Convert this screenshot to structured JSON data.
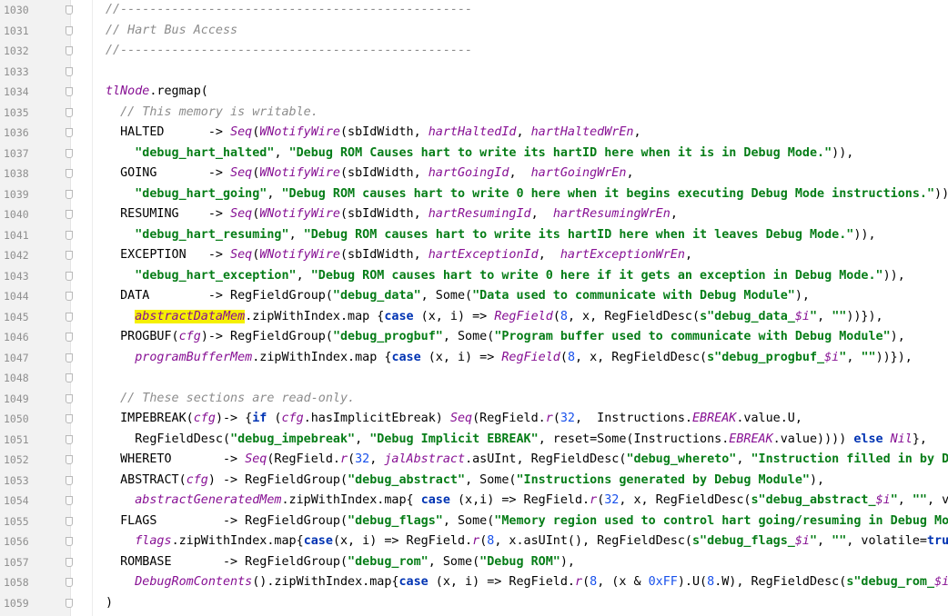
{
  "editor": {
    "lines": [
      {
        "num": "1030",
        "tokens": [
          {
            "t": "cm",
            "v": "//------------------------------------------------"
          }
        ]
      },
      {
        "num": "1031",
        "tokens": [
          {
            "t": "cm",
            "v": "// Hart Bus Access"
          }
        ]
      },
      {
        "num": "1032",
        "tokens": [
          {
            "t": "cm",
            "v": "//------------------------------------------------"
          }
        ]
      },
      {
        "num": "1033",
        "tokens": []
      },
      {
        "num": "1034",
        "tokens": [
          {
            "t": "fn",
            "v": "tlNode"
          },
          {
            "t": "p",
            "v": ".regmap("
          }
        ]
      },
      {
        "num": "1035",
        "tokens": [
          {
            "t": "p",
            "v": "  "
          },
          {
            "t": "cm",
            "v": "// This memory is writable."
          }
        ]
      },
      {
        "num": "1036",
        "tokens": [
          {
            "t": "p",
            "v": "  HALTED      -> "
          },
          {
            "t": "fn",
            "v": "Seq"
          },
          {
            "t": "p",
            "v": "("
          },
          {
            "t": "fn",
            "v": "WNotifyWire"
          },
          {
            "t": "p",
            "v": "(sbIdWidth, "
          },
          {
            "t": "fn",
            "v": "hartHaltedId"
          },
          {
            "t": "p",
            "v": ", "
          },
          {
            "t": "fn",
            "v": "hartHaltedWrEn"
          },
          {
            "t": "p",
            "v": ","
          }
        ]
      },
      {
        "num": "1037",
        "tokens": [
          {
            "t": "p",
            "v": "    "
          },
          {
            "t": "str",
            "v": "\"debug_hart_halted\""
          },
          {
            "t": "p",
            "v": ", "
          },
          {
            "t": "str",
            "v": "\"Debug ROM Causes hart to write its hartID here when it is in Debug Mode.\""
          },
          {
            "t": "p",
            "v": ")),"
          }
        ]
      },
      {
        "num": "1038",
        "tokens": [
          {
            "t": "p",
            "v": "  GOING       -> "
          },
          {
            "t": "fn",
            "v": "Seq"
          },
          {
            "t": "p",
            "v": "("
          },
          {
            "t": "fn",
            "v": "WNotifyWire"
          },
          {
            "t": "p",
            "v": "(sbIdWidth, "
          },
          {
            "t": "fn",
            "v": "hartGoingId"
          },
          {
            "t": "p",
            "v": ",  "
          },
          {
            "t": "fn",
            "v": "hartGoingWrEn"
          },
          {
            "t": "p",
            "v": ","
          }
        ]
      },
      {
        "num": "1039",
        "tokens": [
          {
            "t": "p",
            "v": "    "
          },
          {
            "t": "str",
            "v": "\"debug_hart_going\""
          },
          {
            "t": "p",
            "v": ", "
          },
          {
            "t": "str",
            "v": "\"Debug ROM causes hart to write 0 here when it begins executing Debug Mode instructions.\""
          },
          {
            "t": "p",
            "v": ")),"
          }
        ]
      },
      {
        "num": "1040",
        "tokens": [
          {
            "t": "p",
            "v": "  RESUMING    -> "
          },
          {
            "t": "fn",
            "v": "Seq"
          },
          {
            "t": "p",
            "v": "("
          },
          {
            "t": "fn",
            "v": "WNotifyWire"
          },
          {
            "t": "p",
            "v": "(sbIdWidth, "
          },
          {
            "t": "fn",
            "v": "hartResumingId"
          },
          {
            "t": "p",
            "v": ",  "
          },
          {
            "t": "fn",
            "v": "hartResumingWrEn"
          },
          {
            "t": "p",
            "v": ","
          }
        ]
      },
      {
        "num": "1041",
        "tokens": [
          {
            "t": "p",
            "v": "    "
          },
          {
            "t": "str",
            "v": "\"debug_hart_resuming\""
          },
          {
            "t": "p",
            "v": ", "
          },
          {
            "t": "str",
            "v": "\"Debug ROM causes hart to write its hartID here when it leaves Debug Mode.\""
          },
          {
            "t": "p",
            "v": ")),"
          }
        ]
      },
      {
        "num": "1042",
        "tokens": [
          {
            "t": "p",
            "v": "  EXCEPTION   -> "
          },
          {
            "t": "fn",
            "v": "Seq"
          },
          {
            "t": "p",
            "v": "("
          },
          {
            "t": "fn",
            "v": "WNotifyWire"
          },
          {
            "t": "p",
            "v": "(sbIdWidth, "
          },
          {
            "t": "fn",
            "v": "hartExceptionId"
          },
          {
            "t": "p",
            "v": ",  "
          },
          {
            "t": "fn",
            "v": "hartExceptionWrEn"
          },
          {
            "t": "p",
            "v": ","
          }
        ]
      },
      {
        "num": "1043",
        "tokens": [
          {
            "t": "p",
            "v": "    "
          },
          {
            "t": "str",
            "v": "\"debug_hart_exception\""
          },
          {
            "t": "p",
            "v": ", "
          },
          {
            "t": "str",
            "v": "\"Debug ROM causes hart to write 0 here if it gets an exception in Debug Mode.\""
          },
          {
            "t": "p",
            "v": ")),"
          }
        ]
      },
      {
        "num": "1044",
        "tokens": [
          {
            "t": "p",
            "v": "  DATA        -> RegFieldGroup("
          },
          {
            "t": "str",
            "v": "\"debug_data\""
          },
          {
            "t": "p",
            "v": ", Some("
          },
          {
            "t": "str",
            "v": "\"Data used to communicate with Debug Module\""
          },
          {
            "t": "p",
            "v": "),"
          }
        ]
      },
      {
        "num": "1045",
        "tokens": [
          {
            "t": "p",
            "v": "    "
          },
          {
            "t": "fnhl",
            "v": "abstractDataMem"
          },
          {
            "t": "p",
            "v": ".zipWithIndex.map {"
          },
          {
            "t": "kw",
            "v": "case"
          },
          {
            "t": "p",
            "v": " (x, i) => "
          },
          {
            "t": "fn",
            "v": "RegField"
          },
          {
            "t": "p",
            "v": "("
          },
          {
            "t": "num",
            "v": "8"
          },
          {
            "t": "p",
            "v": ", x, RegFieldDesc("
          },
          {
            "t": "str",
            "v": "s\"debug_data_"
          },
          {
            "t": "fn",
            "v": "$i"
          },
          {
            "t": "str",
            "v": "\""
          },
          {
            "t": "p",
            "v": ", "
          },
          {
            "t": "str",
            "v": "\"\""
          },
          {
            "t": "p",
            "v": "))}),"
          }
        ]
      },
      {
        "num": "1046",
        "tokens": [
          {
            "t": "p",
            "v": "  PROGBUF("
          },
          {
            "t": "fn",
            "v": "cfg"
          },
          {
            "t": "p",
            "v": ")-> RegFieldGroup("
          },
          {
            "t": "str",
            "v": "\"debug_progbuf\""
          },
          {
            "t": "p",
            "v": ", Some("
          },
          {
            "t": "str",
            "v": "\"Program buffer used to communicate with Debug Module\""
          },
          {
            "t": "p",
            "v": "),"
          }
        ]
      },
      {
        "num": "1047",
        "tokens": [
          {
            "t": "p",
            "v": "    "
          },
          {
            "t": "fn",
            "v": "programBufferMem"
          },
          {
            "t": "p",
            "v": ".zipWithIndex.map {"
          },
          {
            "t": "kw",
            "v": "case"
          },
          {
            "t": "p",
            "v": " (x, i) => "
          },
          {
            "t": "fn",
            "v": "RegField"
          },
          {
            "t": "p",
            "v": "("
          },
          {
            "t": "num",
            "v": "8"
          },
          {
            "t": "p",
            "v": ", x, RegFieldDesc("
          },
          {
            "t": "str",
            "v": "s\"debug_progbuf_"
          },
          {
            "t": "fn",
            "v": "$i"
          },
          {
            "t": "str",
            "v": "\""
          },
          {
            "t": "p",
            "v": ", "
          },
          {
            "t": "str",
            "v": "\"\""
          },
          {
            "t": "p",
            "v": "))}),"
          }
        ]
      },
      {
        "num": "1048",
        "tokens": []
      },
      {
        "num": "1049",
        "tokens": [
          {
            "t": "p",
            "v": "  "
          },
          {
            "t": "cm",
            "v": "// These sections are read-only."
          }
        ]
      },
      {
        "num": "1050",
        "tokens": [
          {
            "t": "p",
            "v": "  IMPEBREAK("
          },
          {
            "t": "fn",
            "v": "cfg"
          },
          {
            "t": "p",
            "v": ")-> {"
          },
          {
            "t": "kw",
            "v": "if"
          },
          {
            "t": "p",
            "v": " ("
          },
          {
            "t": "fn",
            "v": "cfg"
          },
          {
            "t": "p",
            "v": ".hasImplicitEbreak) "
          },
          {
            "t": "fn",
            "v": "Seq"
          },
          {
            "t": "p",
            "v": "(RegField."
          },
          {
            "t": "fn",
            "v": "r"
          },
          {
            "t": "p",
            "v": "("
          },
          {
            "t": "num",
            "v": "32"
          },
          {
            "t": "p",
            "v": ",  Instructions."
          },
          {
            "t": "fn",
            "v": "EBREAK"
          },
          {
            "t": "p",
            "v": ".value.U,"
          }
        ]
      },
      {
        "num": "1051",
        "tokens": [
          {
            "t": "p",
            "v": "    RegFieldDesc("
          },
          {
            "t": "str",
            "v": "\"debug_impebreak\""
          },
          {
            "t": "p",
            "v": ", "
          },
          {
            "t": "str",
            "v": "\"Debug Implicit EBREAK\""
          },
          {
            "t": "p",
            "v": ", reset=Some(Instructions."
          },
          {
            "t": "fn",
            "v": "EBREAK"
          },
          {
            "t": "p",
            "v": ".value)))) "
          },
          {
            "t": "kw",
            "v": "else"
          },
          {
            "t": "p",
            "v": " "
          },
          {
            "t": "fn",
            "v": "Nil"
          },
          {
            "t": "p",
            "v": "},"
          }
        ]
      },
      {
        "num": "1052",
        "tokens": [
          {
            "t": "p",
            "v": "  WHERETO       -> "
          },
          {
            "t": "fn",
            "v": "Seq"
          },
          {
            "t": "p",
            "v": "(RegField."
          },
          {
            "t": "fn",
            "v": "r"
          },
          {
            "t": "p",
            "v": "("
          },
          {
            "t": "num",
            "v": "32"
          },
          {
            "t": "p",
            "v": ", "
          },
          {
            "t": "fn",
            "v": "jalAbstract"
          },
          {
            "t": "p",
            "v": ".asUInt, RegFieldDesc("
          },
          {
            "t": "str",
            "v": "\"debug_whereto\""
          },
          {
            "t": "p",
            "v": ", "
          },
          {
            "t": "str",
            "v": "\"Instruction filled in by Debug Module to control hart\""
          }
        ]
      },
      {
        "num": "1053",
        "tokens": [
          {
            "t": "p",
            "v": "  ABSTRACT("
          },
          {
            "t": "fn",
            "v": "cfg"
          },
          {
            "t": "p",
            "v": ") -> RegFieldGroup("
          },
          {
            "t": "str",
            "v": "\"debug_abstract\""
          },
          {
            "t": "p",
            "v": ", Some("
          },
          {
            "t": "str",
            "v": "\"Instructions generated by Debug Module\""
          },
          {
            "t": "p",
            "v": "),"
          }
        ]
      },
      {
        "num": "1054",
        "tokens": [
          {
            "t": "p",
            "v": "    "
          },
          {
            "t": "fn",
            "v": "abstractGeneratedMem"
          },
          {
            "t": "p",
            "v": ".zipWithIndex.map{ "
          },
          {
            "t": "kw",
            "v": "case"
          },
          {
            "t": "p",
            "v": " (x,i) => RegField."
          },
          {
            "t": "fn",
            "v": "r"
          },
          {
            "t": "p",
            "v": "("
          },
          {
            "t": "num",
            "v": "32"
          },
          {
            "t": "p",
            "v": ", x, RegFieldDesc("
          },
          {
            "t": "str",
            "v": "s\"debug_abstract_"
          },
          {
            "t": "fn",
            "v": "$i"
          },
          {
            "t": "str",
            "v": "\""
          },
          {
            "t": "p",
            "v": ", "
          },
          {
            "t": "str",
            "v": "\"\""
          },
          {
            "t": "p",
            "v": ", volatile="
          },
          {
            "t": "kw",
            "v": "true"
          },
          {
            "t": "p",
            "v": "))}),"
          }
        ]
      },
      {
        "num": "1055",
        "tokens": [
          {
            "t": "p",
            "v": "  FLAGS         -> RegFieldGroup("
          },
          {
            "t": "str",
            "v": "\"debug_flags\""
          },
          {
            "t": "p",
            "v": ", Some("
          },
          {
            "t": "str",
            "v": "\"Memory region used to control hart going/resuming in Debug Mode\""
          },
          {
            "t": "p",
            "v": "),"
          }
        ]
      },
      {
        "num": "1056",
        "tokens": [
          {
            "t": "p",
            "v": "    "
          },
          {
            "t": "fn",
            "v": "flags"
          },
          {
            "t": "p",
            "v": ".zipWithIndex.map{"
          },
          {
            "t": "kw",
            "v": "case"
          },
          {
            "t": "p",
            "v": "(x, i) => RegField."
          },
          {
            "t": "fn",
            "v": "r"
          },
          {
            "t": "p",
            "v": "("
          },
          {
            "t": "num",
            "v": "8"
          },
          {
            "t": "p",
            "v": ", x.asUInt(), RegFieldDesc("
          },
          {
            "t": "str",
            "v": "s\"debug_flags_"
          },
          {
            "t": "fn",
            "v": "$i"
          },
          {
            "t": "str",
            "v": "\""
          },
          {
            "t": "p",
            "v": ", "
          },
          {
            "t": "str",
            "v": "\"\""
          },
          {
            "t": "p",
            "v": ", volatile="
          },
          {
            "t": "kw",
            "v": "true"
          },
          {
            "t": "p",
            "v": "))}),"
          }
        ]
      },
      {
        "num": "1057",
        "tokens": [
          {
            "t": "p",
            "v": "  ROMBASE       -> RegFieldGroup("
          },
          {
            "t": "str",
            "v": "\"debug_rom\""
          },
          {
            "t": "p",
            "v": ", Some("
          },
          {
            "t": "str",
            "v": "\"Debug ROM\""
          },
          {
            "t": "p",
            "v": "),"
          }
        ]
      },
      {
        "num": "1058",
        "tokens": [
          {
            "t": "p",
            "v": "    "
          },
          {
            "t": "fn",
            "v": "DebugRomContents"
          },
          {
            "t": "p",
            "v": "().zipWithIndex.map{"
          },
          {
            "t": "kw",
            "v": "case"
          },
          {
            "t": "p",
            "v": " (x, i) => RegField."
          },
          {
            "t": "fn",
            "v": "r"
          },
          {
            "t": "p",
            "v": "("
          },
          {
            "t": "num",
            "v": "8"
          },
          {
            "t": "p",
            "v": ", (x & "
          },
          {
            "t": "num",
            "v": "0xFF"
          },
          {
            "t": "p",
            "v": ").U("
          },
          {
            "t": "num",
            "v": "8"
          },
          {
            "t": "p",
            "v": ".W), RegFieldDesc("
          },
          {
            "t": "str",
            "v": "s\"debug_rom_"
          },
          {
            "t": "fn",
            "v": "$i"
          },
          {
            "t": "str",
            "v": "\""
          },
          {
            "t": "p",
            "v": ", "
          },
          {
            "t": "str",
            "v": "\"\""
          },
          {
            "t": "p",
            "v": "))}"
          }
        ]
      },
      {
        "num": "1059",
        "tokens": [
          {
            "t": "p",
            "v": ")"
          }
        ]
      }
    ]
  }
}
